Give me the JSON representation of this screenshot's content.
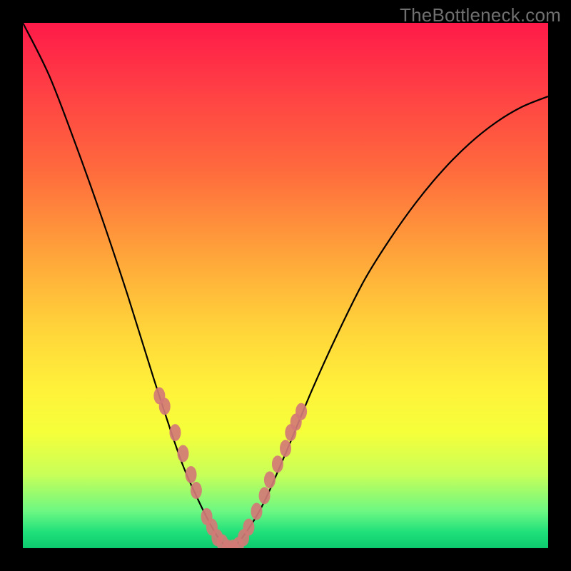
{
  "watermark": "TheBottleneck.com",
  "colors": {
    "black": "#000000",
    "curve": "#000000",
    "marker": "#d27a76",
    "gradient_top": "#ff1a49",
    "gradient_bottom": "#0cc96e"
  },
  "chart_data": {
    "type": "line",
    "title": "",
    "xlabel": "",
    "ylabel": "",
    "xlim": [
      0,
      100
    ],
    "ylim": [
      0,
      100
    ],
    "grid": false,
    "legend": false,
    "series": [
      {
        "name": "bottleneck-curve",
        "x": [
          0,
          5,
          10,
          15,
          20,
          25,
          30,
          33,
          36,
          38,
          40,
          45,
          50,
          55,
          60,
          65,
          70,
          75,
          80,
          85,
          90,
          95,
          100
        ],
        "y": [
          100,
          90,
          77,
          63,
          48,
          32,
          17,
          10,
          4,
          1,
          0,
          7,
          18,
          30,
          41,
          51,
          59,
          66,
          72,
          77,
          81,
          84,
          86
        ]
      }
    ],
    "markers": {
      "name": "highlighted-points",
      "x": [
        26,
        27,
        29,
        30.5,
        32,
        33,
        35,
        36,
        37,
        38,
        39,
        40,
        41,
        42,
        43,
        44.5,
        46,
        47,
        48.5,
        50,
        51,
        52,
        53
      ],
      "y": [
        29,
        27,
        22,
        18,
        14,
        11,
        6,
        4,
        2,
        1,
        0,
        0,
        0.5,
        2,
        4,
        7,
        10,
        13,
        16,
        19,
        22,
        24,
        26
      ]
    }
  }
}
